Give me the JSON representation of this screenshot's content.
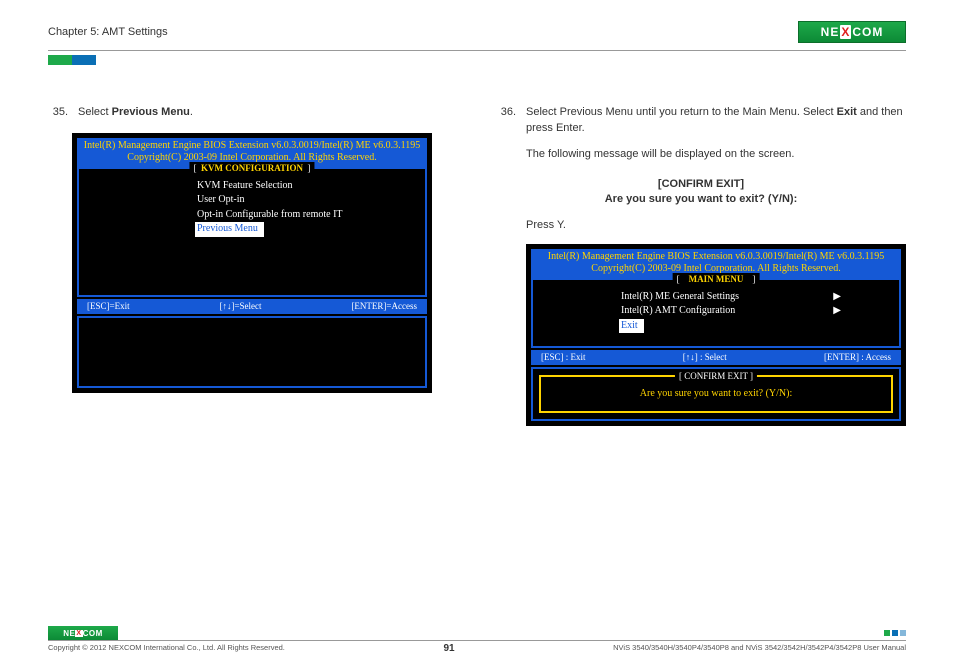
{
  "header": {
    "chapter": "Chapter 5: AMT Settings",
    "logo_text_a": "NE",
    "logo_text_x": "X",
    "logo_text_b": "COM"
  },
  "left": {
    "step_num": "35.",
    "step_text_a": "Select ",
    "step_text_b": "Previous Menu",
    "step_text_c": ".",
    "bios": {
      "top1": "Intel(R) Management Engine BIOS Extension v6.0.3.0019/Intel(R) ME v6.0.3.1195",
      "top2": "Copyright(C) 2003-09 Intel Corporation. All Rights Reserved.",
      "frame_title": "KVM CONFIGURATION",
      "items": [
        "KVM Feature Selection",
        "User Opt-in",
        "Opt-in Configurable from remote IT",
        "Previous Menu"
      ],
      "key1": "[ESC]=Exit",
      "key2": "[↑↓]=Select",
      "key3": "[ENTER]=Access"
    }
  },
  "right": {
    "step_num": "36.",
    "step_text": "Select Previous Menu until you return to the Main Menu. Select ",
    "step_bold": "Exit",
    "step_text2": " and then press Enter.",
    "para2": "The following message will be displayed on the screen.",
    "confirm1": "[CONFIRM EXIT]",
    "confirm2": "Are you sure you want to exit? (Y/N):",
    "para3": "Press Y.",
    "bios": {
      "top1": "Intel(R) Management Engine BIOS Extension v6.0.3.0019/Intel(R) ME v6.0.3.1195",
      "top2": "Copyright(C) 2003-09 Intel Corporation. All Rights Reserved.",
      "frame_title": "MAIN MENU",
      "items": [
        "Intel(R) ME General Settings",
        "Intel(R) AMT Configuration",
        "Exit"
      ],
      "key1": "[ESC] : Exit",
      "key2": "[↑↓] : Select",
      "key3": "[ENTER] : Access",
      "confirm_title": "[ CONFIRM EXIT ]",
      "confirm_body": "Are you sure you want to exit? (Y/N):"
    }
  },
  "footer": {
    "copyright": "Copyright © 2012 NEXCOM International Co., Ltd. All Rights Reserved.",
    "page_num": "91",
    "model": "NViS 3540/3540H/3540P4/3540P8 and NViS 3542/3542H/3542P4/3542P8 User Manual"
  }
}
